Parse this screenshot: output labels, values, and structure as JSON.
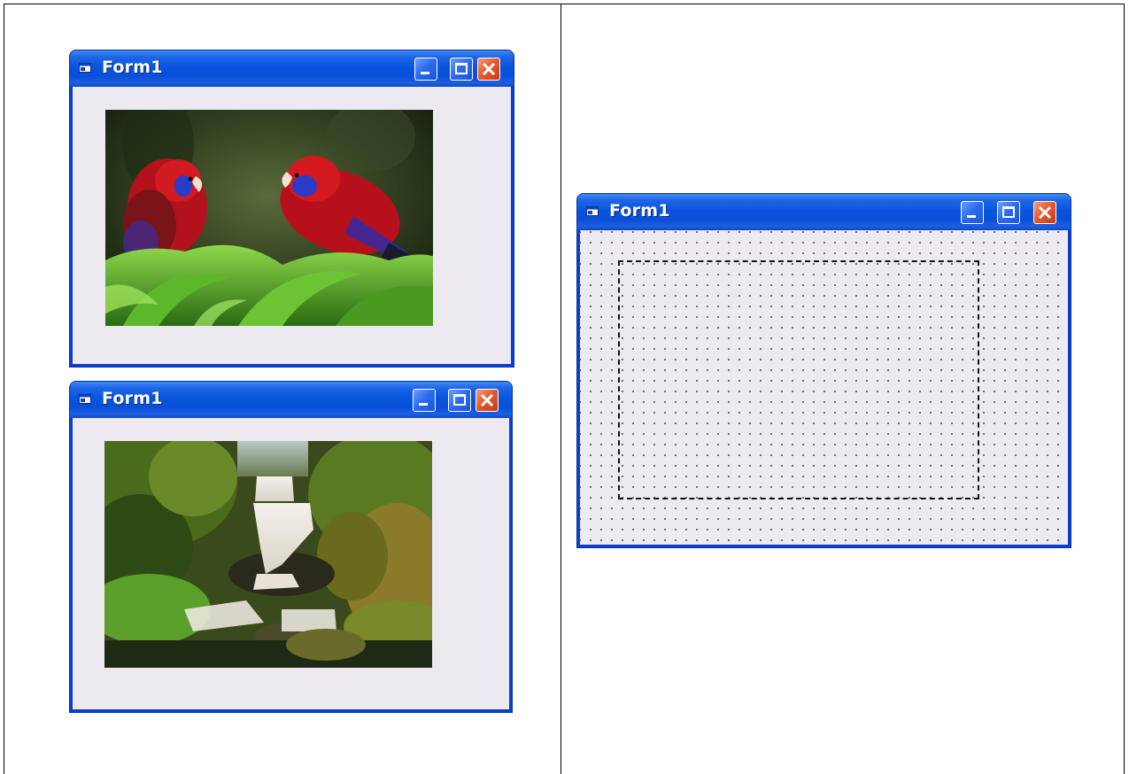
{
  "windows": [
    {
      "title": "Form1",
      "picture": "parrots-image"
    },
    {
      "title": "Form1",
      "picture": "waterfall-image"
    },
    {
      "title": "Form1",
      "picture": "picturebox-placeholder"
    }
  ],
  "colors": {
    "titlebar": "#0855dd",
    "client": "#ece9f0",
    "close_button": "#e2582d"
  },
  "icons": [
    "form-icon",
    "minimize-icon",
    "maximize-icon",
    "close-icon"
  ]
}
